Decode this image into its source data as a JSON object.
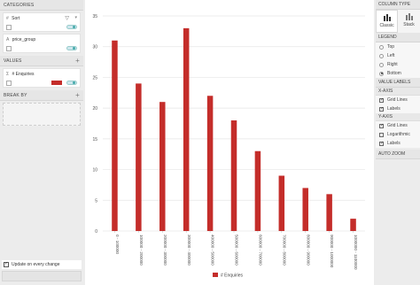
{
  "left_panel": {
    "categories_title": "CATEGORIES",
    "categories": [
      {
        "symbol": "#",
        "label": "Sort"
      },
      {
        "symbol": "A",
        "label": "price_group"
      }
    ],
    "values_title": "VALUES",
    "values": [
      {
        "symbol": "Σ",
        "label": "# Enquiries",
        "color": "#c42d2a"
      }
    ],
    "break_by_title": "BREAK BY",
    "update_label": "Update on every change",
    "plus": "+"
  },
  "right_panel": {
    "column_type_title": "COLUMN TYPE",
    "column_types": [
      {
        "label": "Classic",
        "icon": "bar-chart-icon"
      },
      {
        "label": "Stack",
        "icon": "stacked-bar-icon"
      }
    ],
    "legend_title": "LEGEND",
    "legend_options": [
      "Top",
      "Left",
      "Right",
      "Bottom"
    ],
    "legend_selected": "Bottom",
    "value_labels_title": "VALUE LABELS",
    "x_axis_title": "X-AXIS",
    "x_axis_options": [
      {
        "label": "Grid Lines",
        "checked": true
      },
      {
        "label": "Labels",
        "checked": true
      }
    ],
    "y_axis_title": "Y-AXIS",
    "y_axis_options": [
      {
        "label": "Grid Lines",
        "checked": true
      },
      {
        "label": "Logarithmic",
        "checked": false
      },
      {
        "label": "Labels",
        "checked": true
      }
    ],
    "auto_zoom_title": "AUTO ZOOM"
  },
  "chart_data": {
    "type": "bar",
    "categories": [
      "0 - 100000",
      "100000 - 200000",
      "200000 - 300000",
      "300000 - 400000",
      "400000 - 500000",
      "500000 - 600000",
      "600000 - 700000",
      "700000 - 800000",
      "800000 - 900000",
      "900000 - 1000000",
      "1000000 - 1100000"
    ],
    "series": [
      {
        "name": "# Enquiries",
        "values": [
          31,
          24,
          21,
          33,
          22,
          18,
          13,
          9,
          7,
          6,
          2
        ],
        "color": "#c42d2a"
      }
    ],
    "yticks": [
      "0",
      "5",
      "10",
      "15",
      "20",
      "25",
      "30",
      "35"
    ],
    "ylim": [
      0,
      35
    ],
    "grid": true,
    "legend_position": "bottom"
  }
}
